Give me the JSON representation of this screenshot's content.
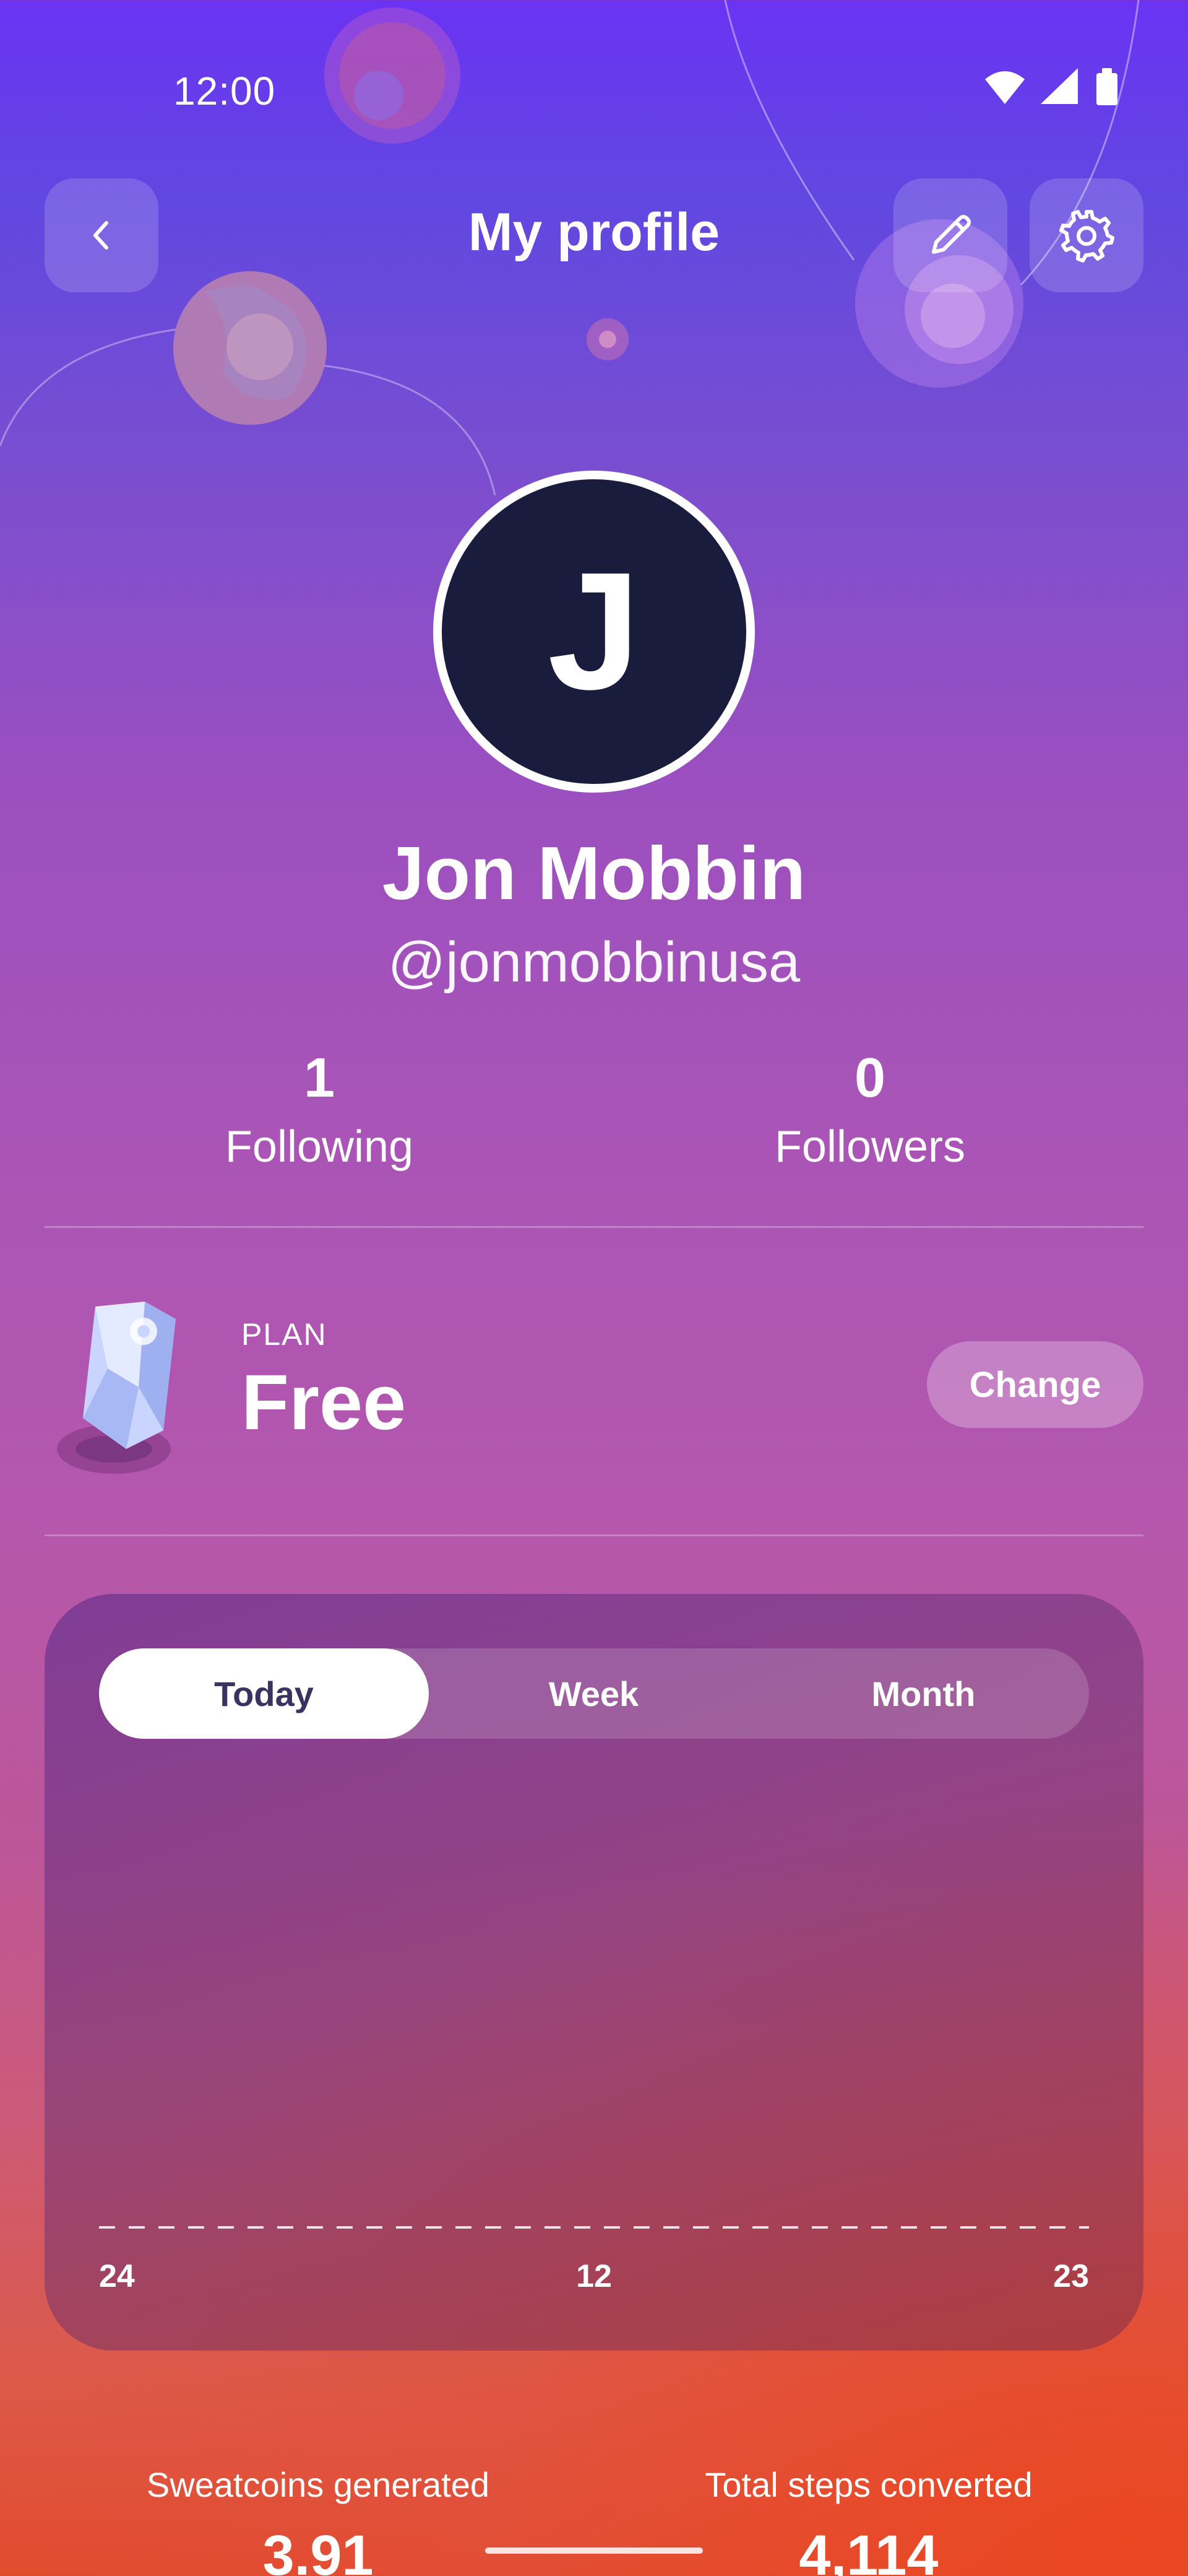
{
  "status_bar": {
    "time": "12:00",
    "icons": [
      "wifi-icon",
      "signal-icon",
      "battery-icon"
    ]
  },
  "header": {
    "title": "My profile",
    "back_icon": "chevron-left-icon",
    "edit_icon": "pencil-icon",
    "settings_icon": "gear-icon"
  },
  "profile": {
    "avatar_initial": "J",
    "name": "Jon Mobbin",
    "handle": "@jonmobbinusa"
  },
  "social": {
    "following": {
      "value": "1",
      "label": "Following"
    },
    "followers": {
      "value": "0",
      "label": "Followers"
    }
  },
  "plan": {
    "label": "PLAN",
    "value": "Free",
    "change_label": "Change",
    "icon": "crystal-icon"
  },
  "chart": {
    "tabs": [
      "Today",
      "Week",
      "Month"
    ],
    "active_tab": "Today",
    "ticks": [
      "24",
      "12",
      "23"
    ]
  },
  "summary": {
    "sweatcoins": {
      "label": "Sweatcoins generated",
      "value": "3.91"
    },
    "steps": {
      "label": "Total steps converted",
      "value": "4,114"
    }
  },
  "colors": {
    "avatar_bg": "#1a1c3e",
    "gradient_top": "#6a33f3",
    "gradient_bottom": "#e24b2e",
    "active_tab_text": "#3a3360"
  }
}
